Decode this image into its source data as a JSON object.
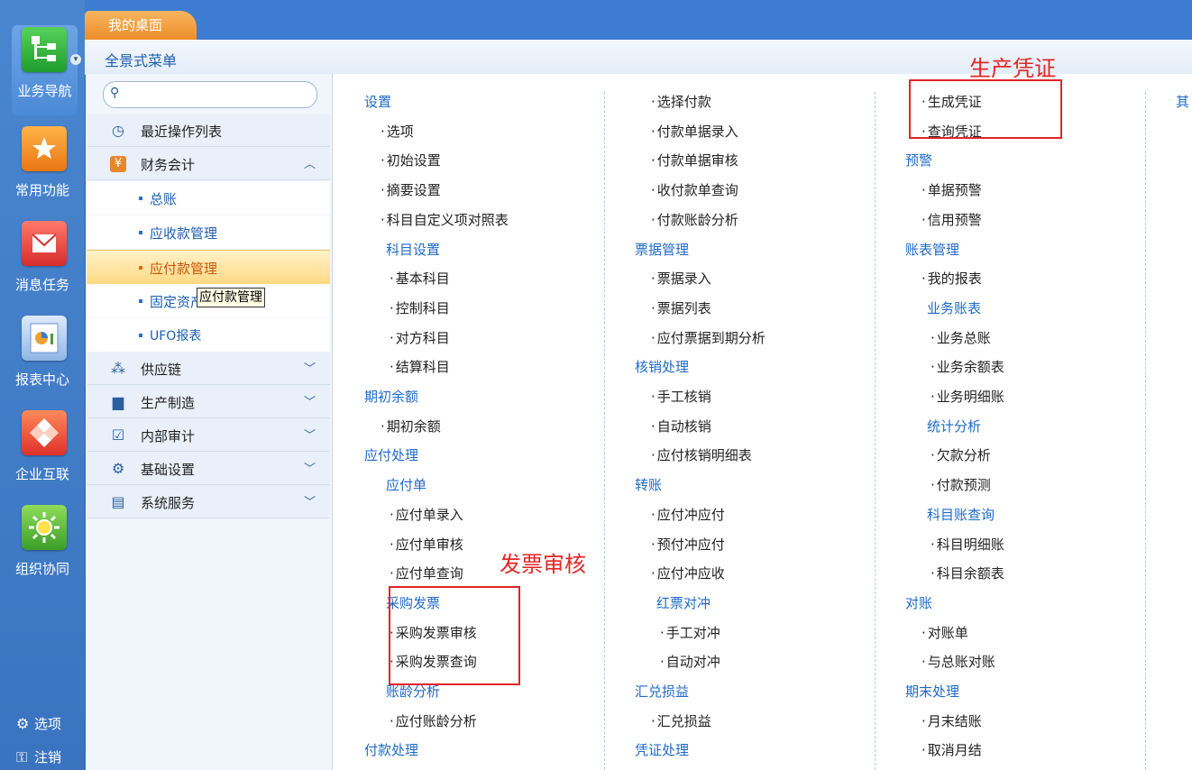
{
  "left_nav": {
    "items": [
      {
        "label": "业务导航",
        "icon": "tree-structure-icon",
        "color": "#2ea53a"
      },
      {
        "label": "常用功能",
        "icon": "star-folder-icon",
        "color": "#f08a1c"
      },
      {
        "label": "消息任务",
        "icon": "mail-icon",
        "color": "#e2423a"
      },
      {
        "label": "报表中心",
        "icon": "report-chart-icon",
        "color": "#5a8fd6"
      },
      {
        "label": "企业互联",
        "icon": "network-icon",
        "color": "#e84a3a"
      },
      {
        "label": "组织协同",
        "icon": "sun-gear-icon",
        "color": "#5db548"
      }
    ],
    "bottom": [
      {
        "label": "选项",
        "icon": "gear-icon"
      },
      {
        "label": "注销",
        "icon": "key-icon"
      }
    ]
  },
  "tabs": {
    "desk": "我的桌面"
  },
  "subheader": {
    "title": "全景式菜单"
  },
  "search": {
    "placeholder": ""
  },
  "sidebar": {
    "items": [
      {
        "label": "最近操作列表",
        "icon": "clock-icon"
      },
      {
        "label": "财务会计",
        "icon": "yen-icon",
        "chevron": "up"
      },
      {
        "label": "供应链",
        "icon": "supply-chain-icon",
        "chevron": "down"
      },
      {
        "label": "生产制造",
        "icon": "factory-icon",
        "chevron": "down"
      },
      {
        "label": "内部审计",
        "icon": "checklist-icon",
        "chevron": "down"
      },
      {
        "label": "基础设置",
        "icon": "settings-icon",
        "chevron": "down"
      },
      {
        "label": "系统服务",
        "icon": "service-icon",
        "chevron": "down"
      }
    ],
    "sub_items": [
      "总账",
      "应收款管理",
      "应付款管理",
      "固定资产",
      "UFO报表"
    ],
    "selected": "应付款管理",
    "tooltip": "应付款管理"
  },
  "content": {
    "col1": [
      "设置",
      "选项",
      "初始设置",
      "摘要设置",
      "科目自定义项对照表",
      "科目设置",
      "基本科目",
      "控制科目",
      "对方科目",
      "结算科目",
      "期初余额",
      "期初余额",
      "应付处理",
      "应付单",
      "应付单录入",
      "应付单审核",
      "应付单查询",
      "采购发票",
      "采购发票审核",
      "采购发票查询",
      "账龄分析",
      "应付账龄分析",
      "付款处理"
    ],
    "col2": [
      "选择付款",
      "付款单据录入",
      "付款单据审核",
      "收付款单查询",
      "付款账龄分析",
      "票据管理",
      "票据录入",
      "票据列表",
      "应付票据到期分析",
      "核销处理",
      "手工核销",
      "自动核销",
      "应付核销明细表",
      "转账",
      "应付冲应付",
      "预付冲应付",
      "应付冲应收",
      "红票对冲",
      "手工对冲",
      "自动对冲",
      "汇兑损益",
      "汇兑损益",
      "凭证处理"
    ],
    "col3": [
      "生成凭证",
      "查询凭证",
      "预警",
      "单据预警",
      "信用预警",
      "账表管理",
      "我的报表",
      "业务账表",
      "业务总账",
      "业务余额表",
      "业务明细账",
      "统计分析",
      "欠款分析",
      "付款预测",
      "科目账查询",
      "科目明细账",
      "科目余额表",
      "对账",
      "对账单",
      "与总账对账",
      "期末处理",
      "月末结账",
      "取消月结"
    ],
    "col4": [
      "其"
    ]
  },
  "annotations": {
    "label1": "生产凭证",
    "label2": "发票审核"
  }
}
